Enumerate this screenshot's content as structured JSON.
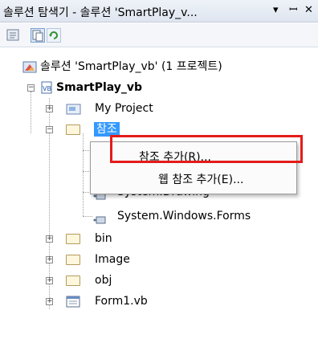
{
  "window": {
    "title": "솔루션 탐색기 - 솔루션 'SmartPlay_v...",
    "dropdown_glyph": "▾",
    "pin_glyph": "ꟷ",
    "close_glyph": "✕"
  },
  "toolbar": {
    "buttons": [
      "properties-icon",
      "show-all-files-icon",
      "refresh-icon"
    ]
  },
  "tree": {
    "solution_label": "솔루션 'SmartPlay_vb' (1 프로젝트)",
    "project_label": "SmartPlay_vb",
    "my_project_label": "My Project",
    "references_label": "참조",
    "references_children": [
      "",
      "",
      "System.Drawing",
      "System.Windows.Forms"
    ],
    "folders": [
      "bin",
      "Image",
      "obj"
    ],
    "form_label": "Form1.vb"
  },
  "context_menu": {
    "items": [
      "참조 추가(R)...",
      "웹 참조 추가(E)..."
    ]
  },
  "colors": {
    "highlight_border": "#e41b1b",
    "selection_bg": "#3399ff",
    "accent": "#4a7cc0"
  }
}
